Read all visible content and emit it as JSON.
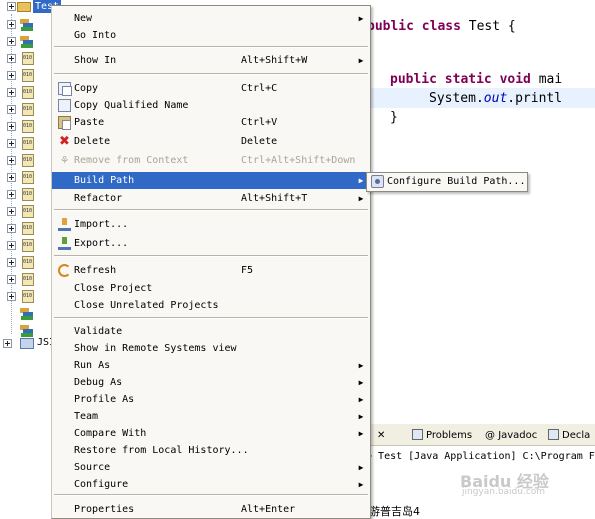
{
  "explorer": {
    "project_name": "Test",
    "other_project_label": "JSI"
  },
  "editor": {
    "line1_keywords": "public class",
    "line1_name": "Test {",
    "line2_keywords": "public static void",
    "line2_name": "mai",
    "line3_prefix": "System.",
    "line3_field": "out",
    "line3_suffix": ".printl",
    "line4": "}"
  },
  "context_menu": {
    "items": [
      {
        "label": "New",
        "accel": "",
        "submenu": true
      },
      {
        "label": "Go Into",
        "accel": "",
        "submenu": false
      },
      {
        "label": "Show In",
        "accel": "Alt+Shift+W",
        "submenu": true
      },
      {
        "label": "Copy",
        "accel": "Ctrl+C",
        "submenu": false,
        "icon": "copy-icon"
      },
      {
        "label": "Copy Qualified Name",
        "accel": "",
        "submenu": false,
        "icon": "copy-qualified-name-icon"
      },
      {
        "label": "Paste",
        "accel": "Ctrl+V",
        "submenu": false,
        "icon": "paste-icon"
      },
      {
        "label": "Delete",
        "accel": "Delete",
        "submenu": false,
        "icon": "delete-icon"
      },
      {
        "label": "Remove from Context",
        "accel": "Ctrl+Alt+Shift+Down",
        "submenu": false,
        "disabled": true,
        "icon": "remove-from-context-icon"
      },
      {
        "label": "Build Path",
        "accel": "",
        "submenu": true,
        "highlighted": true
      },
      {
        "label": "Refactor",
        "accel": "Alt+Shift+T",
        "submenu": true
      },
      {
        "label": "Import...",
        "accel": "",
        "submenu": false,
        "icon": "import-icon"
      },
      {
        "label": "Export...",
        "accel": "",
        "submenu": false,
        "icon": "export-icon"
      },
      {
        "label": "Refresh",
        "accel": "F5",
        "submenu": false,
        "icon": "refresh-icon"
      },
      {
        "label": "Close Project",
        "accel": "",
        "submenu": false
      },
      {
        "label": "Close Unrelated Projects",
        "accel": "",
        "submenu": false
      },
      {
        "label": "Validate",
        "accel": "",
        "submenu": false
      },
      {
        "label": "Show in Remote Systems view",
        "accel": "",
        "submenu": false
      },
      {
        "label": "Run As",
        "accel": "",
        "submenu": true
      },
      {
        "label": "Debug As",
        "accel": "",
        "submenu": true
      },
      {
        "label": "Profile As",
        "accel": "",
        "submenu": true
      },
      {
        "label": "Team",
        "accel": "",
        "submenu": true
      },
      {
        "label": "Compare With",
        "accel": "",
        "submenu": true
      },
      {
        "label": "Restore from Local History...",
        "accel": "",
        "submenu": false
      },
      {
        "label": "Source",
        "accel": "",
        "submenu": true
      },
      {
        "label": "Configure",
        "accel": "",
        "submenu": true
      },
      {
        "label": "Properties",
        "accel": "Alt+Enter",
        "submenu": false
      }
    ],
    "arrow_glyph": "▶"
  },
  "submenu": {
    "configure_build_path": "Configure Build Path..."
  },
  "console": {
    "tab_problems": "Problems",
    "tab_javadoc": "Javadoc",
    "tab_declaration": "Decla",
    "status": "d> Test [Java Application] C:\\Program Fi",
    "tab_close_glyph": "✕"
  },
  "watermark": {
    "text": "Baidu 经验",
    "url": "jingyan.baidu.com"
  },
  "caption": "游普吉岛4"
}
